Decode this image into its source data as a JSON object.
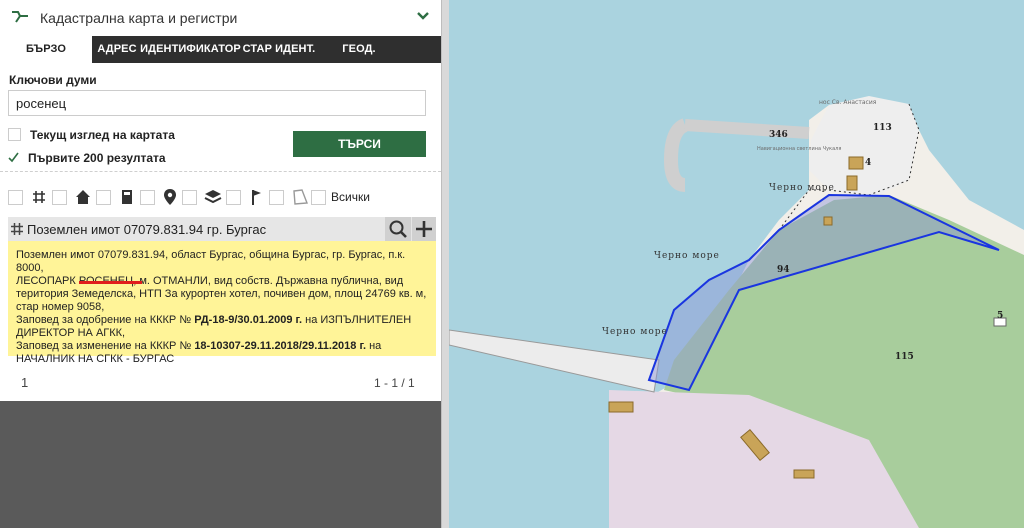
{
  "header": {
    "title": "Кадастрална карта и регистри"
  },
  "tabs": [
    "БЪРЗО ТЪРСЕНЕ",
    "АДРЕС",
    "ИДЕНТИФИКАТОР",
    "СТАР ИДЕНТ.",
    "ГЕОД. ОСНОВА"
  ],
  "search": {
    "keywords_label": "Ключови думи",
    "value": "росенец",
    "current_view_label": "Текущ изглед на картата",
    "first200_label": "Първите 200 резултата",
    "button": "ТЪРСИ"
  },
  "filters": {
    "all_label": "Всички"
  },
  "result": {
    "title": "Поземлен имот 07079.831.94 гр. Бургас",
    "line1": "Поземлен имот 07079.831.94, област Бургас, община Бургас, гр. Бургас, п.к. 8000,",
    "line2": "ЛЕСОПАРК РОСЕНЕЦ, м. ОТМАНЛИ, вид собств. Държавна публична, вид",
    "line3": "територия Земеделска, НТП За курортен хотел, почивен дом, площ 24769 кв. м,",
    "line4": "стар номер 9058,",
    "order1_pre": "Заповед за одобрение на КККР № ",
    "order1_num": "РД-18-9/30.01.2009 г.",
    "order1_post": " на ИЗПЪЛНИТЕЛЕН",
    "order1_cont": "ДИРЕКТОР НА АГКК,",
    "order2_pre": "Заповед за изменение на КККР № ",
    "order2_num": "18-10307-29.11.2018/29.11.2018 г.",
    "order2_post": " на",
    "order2_cont": "НАЧАЛНИК НА СГКК - БУРГАС"
  },
  "pager": {
    "page": "1",
    "range": "1 - 1 / 1"
  },
  "map": {
    "sea_label": "Черно море",
    "parcel_labels": [
      "346",
      "113",
      "4",
      "94",
      "115",
      "5"
    ],
    "lighthouse_label": "Навигационна светлина Чукаля",
    "cape_label": "нос Св. Анастасия"
  },
  "colors": {
    "accent_green": "#2e6e43",
    "result_bg": "#fff498",
    "sea": "#aad3df",
    "parcel_outline": "#1a35e0"
  }
}
